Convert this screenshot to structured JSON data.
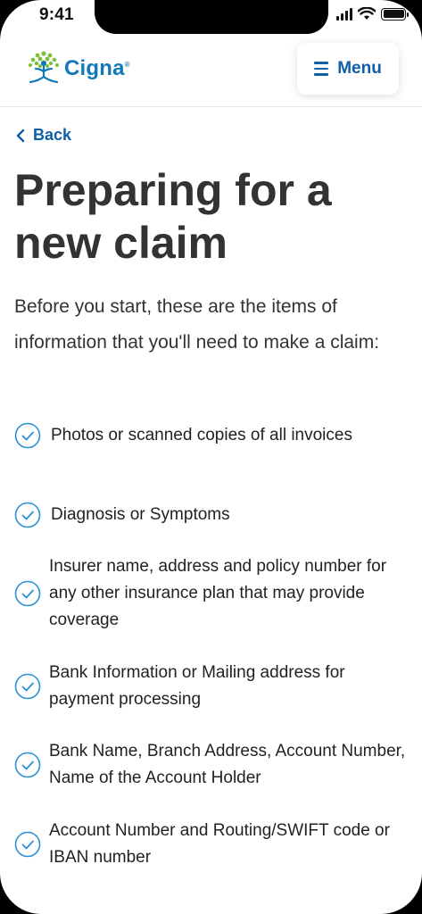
{
  "status_bar": {
    "time": "9:41"
  },
  "header": {
    "logo_text": "Cigna",
    "logo_mark": "®",
    "menu_label": "Menu"
  },
  "nav": {
    "back_label": "Back"
  },
  "page": {
    "title": "Preparing for a new claim",
    "intro": "Before you start, these are the items of information that you'll need to make a claim:",
    "checklist": [
      "Photos or scanned copies of all invoices",
      "Diagnosis or Symptoms",
      "Insurer name, address and policy number for any other insurance plan that may provide coverage",
      "Bank Information or Mailing address for payment processing",
      "Bank Name, Branch Address, Account Number, Name of the Account Holder",
      "Account Number and Routing/SWIFT code or IBAN number"
    ]
  },
  "colors": {
    "brand_blue": "#0f5fa6",
    "check_blue": "#2a8fd6",
    "logo_green": "#7bbf3a",
    "text_dark": "#333333"
  },
  "icons": [
    "signal-icon",
    "wifi-icon",
    "battery-icon",
    "cigna-tree-logo",
    "hamburger-icon",
    "chevron-left-icon",
    "check-circle-icon"
  ]
}
